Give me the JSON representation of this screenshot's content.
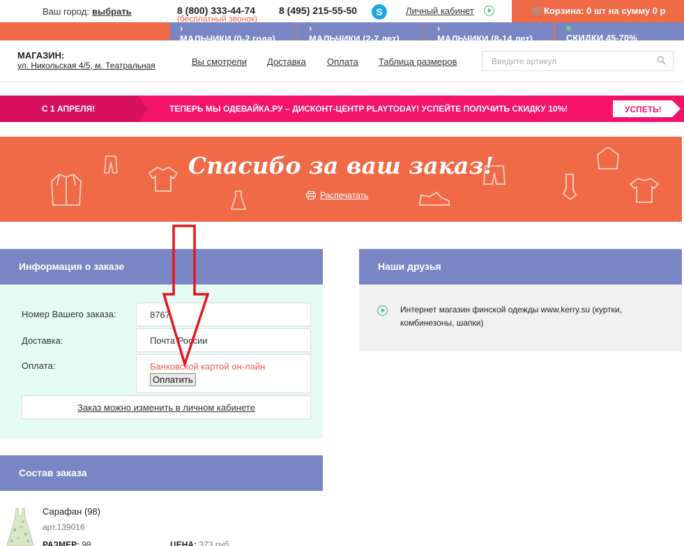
{
  "topbar": {
    "city_label": "Ваш город:",
    "city_pick": "выбрать",
    "phone1": "8 (800) 333-44-74",
    "phone1_note": "(бесплатный звонок)",
    "phone2": "8 (495) 215-55-50",
    "skype_glyph": "S",
    "cabinet": "Личный кабинет",
    "cart_glyph": "🛒",
    "cart": "Корзина: 0 шт на сумму 0 р"
  },
  "nav_tabs": [
    {
      "label": "МАЛЬЧИКИ (0-2 года)"
    },
    {
      "label": "МАЛЬЧИКИ (2-7 лет)"
    },
    {
      "label": "МАЛЬЧИКИ (8-14 лет)"
    },
    {
      "label": "СКИДКИ 45-70%"
    }
  ],
  "store": {
    "label": "МАГАЗИН:",
    "address": "ул. Никольская 4/5, м. Театральная",
    "links": [
      "Вы смотрели",
      "Доставка",
      "Оплата",
      "Таблица размеров"
    ],
    "search_placeholder": "Введите артикул"
  },
  "promo": {
    "left": "С 1 АПРЕЛЯ!",
    "text": "ТЕПЕРЬ МЫ ОДЕВАЙКА.РУ – ДИСКОНТ-ЦЕНТР PLAYTODAY! УСПЕЙТЕ ПОЛУЧИТЬ СКИДКУ 10%!",
    "button": "УСПЕТЬ!"
  },
  "thanks": {
    "title": "Спасибо за ваш заказ!",
    "print": "Распечатать"
  },
  "order_info": {
    "heading": "Информация о заказе",
    "number_label": "Номер Вашего заказа:",
    "number_value": "8767",
    "delivery_label": "Доставка:",
    "delivery_value": "Почта России",
    "payment_label": "Оплата:",
    "payment_method": "Банковской картой он-лайн",
    "pay_button": "Оплатить",
    "change_note": "Заказ можно изменить в личном кабинете"
  },
  "friends": {
    "heading": "Наши друзья",
    "item": "Интернет магазин финской одежды www.kerry.su (куртки, комбинезоны, шапки)"
  },
  "composition": {
    "heading": "Состав заказа",
    "item_name": "Сарафан (98)",
    "item_art": "арт.139016",
    "size_label": "РАЗМЕР:",
    "size_value": "98",
    "price_label": "ЦЕНА:",
    "price_value": "373 руб"
  },
  "colors": {
    "brand_orange": "#f06a47",
    "nav_purple": "#7a86c4",
    "promo_pink": "#f5136a",
    "mint": "#e6faf4",
    "arrow_red": "#e8141b"
  }
}
